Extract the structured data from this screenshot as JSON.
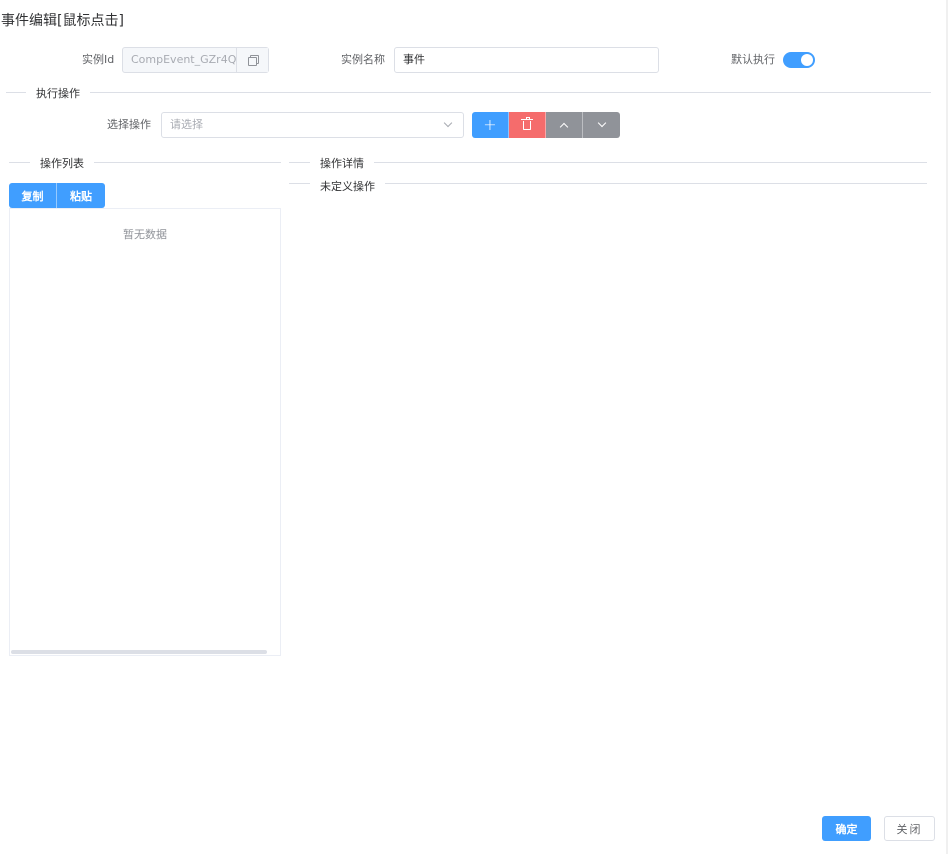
{
  "dialog": {
    "title": "事件编辑[鼠标点击]"
  },
  "instance": {
    "id_label": "实例Id",
    "id_value": "CompEvent_GZr4Q",
    "name_label": "实例名称",
    "name_value": "事件",
    "default_label": "默认执行",
    "default_on": true
  },
  "execute": {
    "section_title": "执行操作",
    "select_label": "选择操作",
    "select_placeholder": "请选择",
    "buttons": {
      "add_icon": "plus-icon",
      "delete_icon": "trash-icon",
      "up_icon": "chevron-up-icon",
      "down_icon": "chevron-down-icon"
    }
  },
  "op_list": {
    "title": "操作列表",
    "copy_label": "复制",
    "paste_label": "粘贴",
    "empty_text": "暂无数据"
  },
  "op_detail": {
    "title": "操作详情",
    "undefined_label": "未定义操作"
  },
  "footer": {
    "confirm_label": "确定",
    "close_label": "关闭"
  },
  "colors": {
    "primary": "#409eff",
    "danger": "#f56c6c",
    "info": "#909399"
  }
}
